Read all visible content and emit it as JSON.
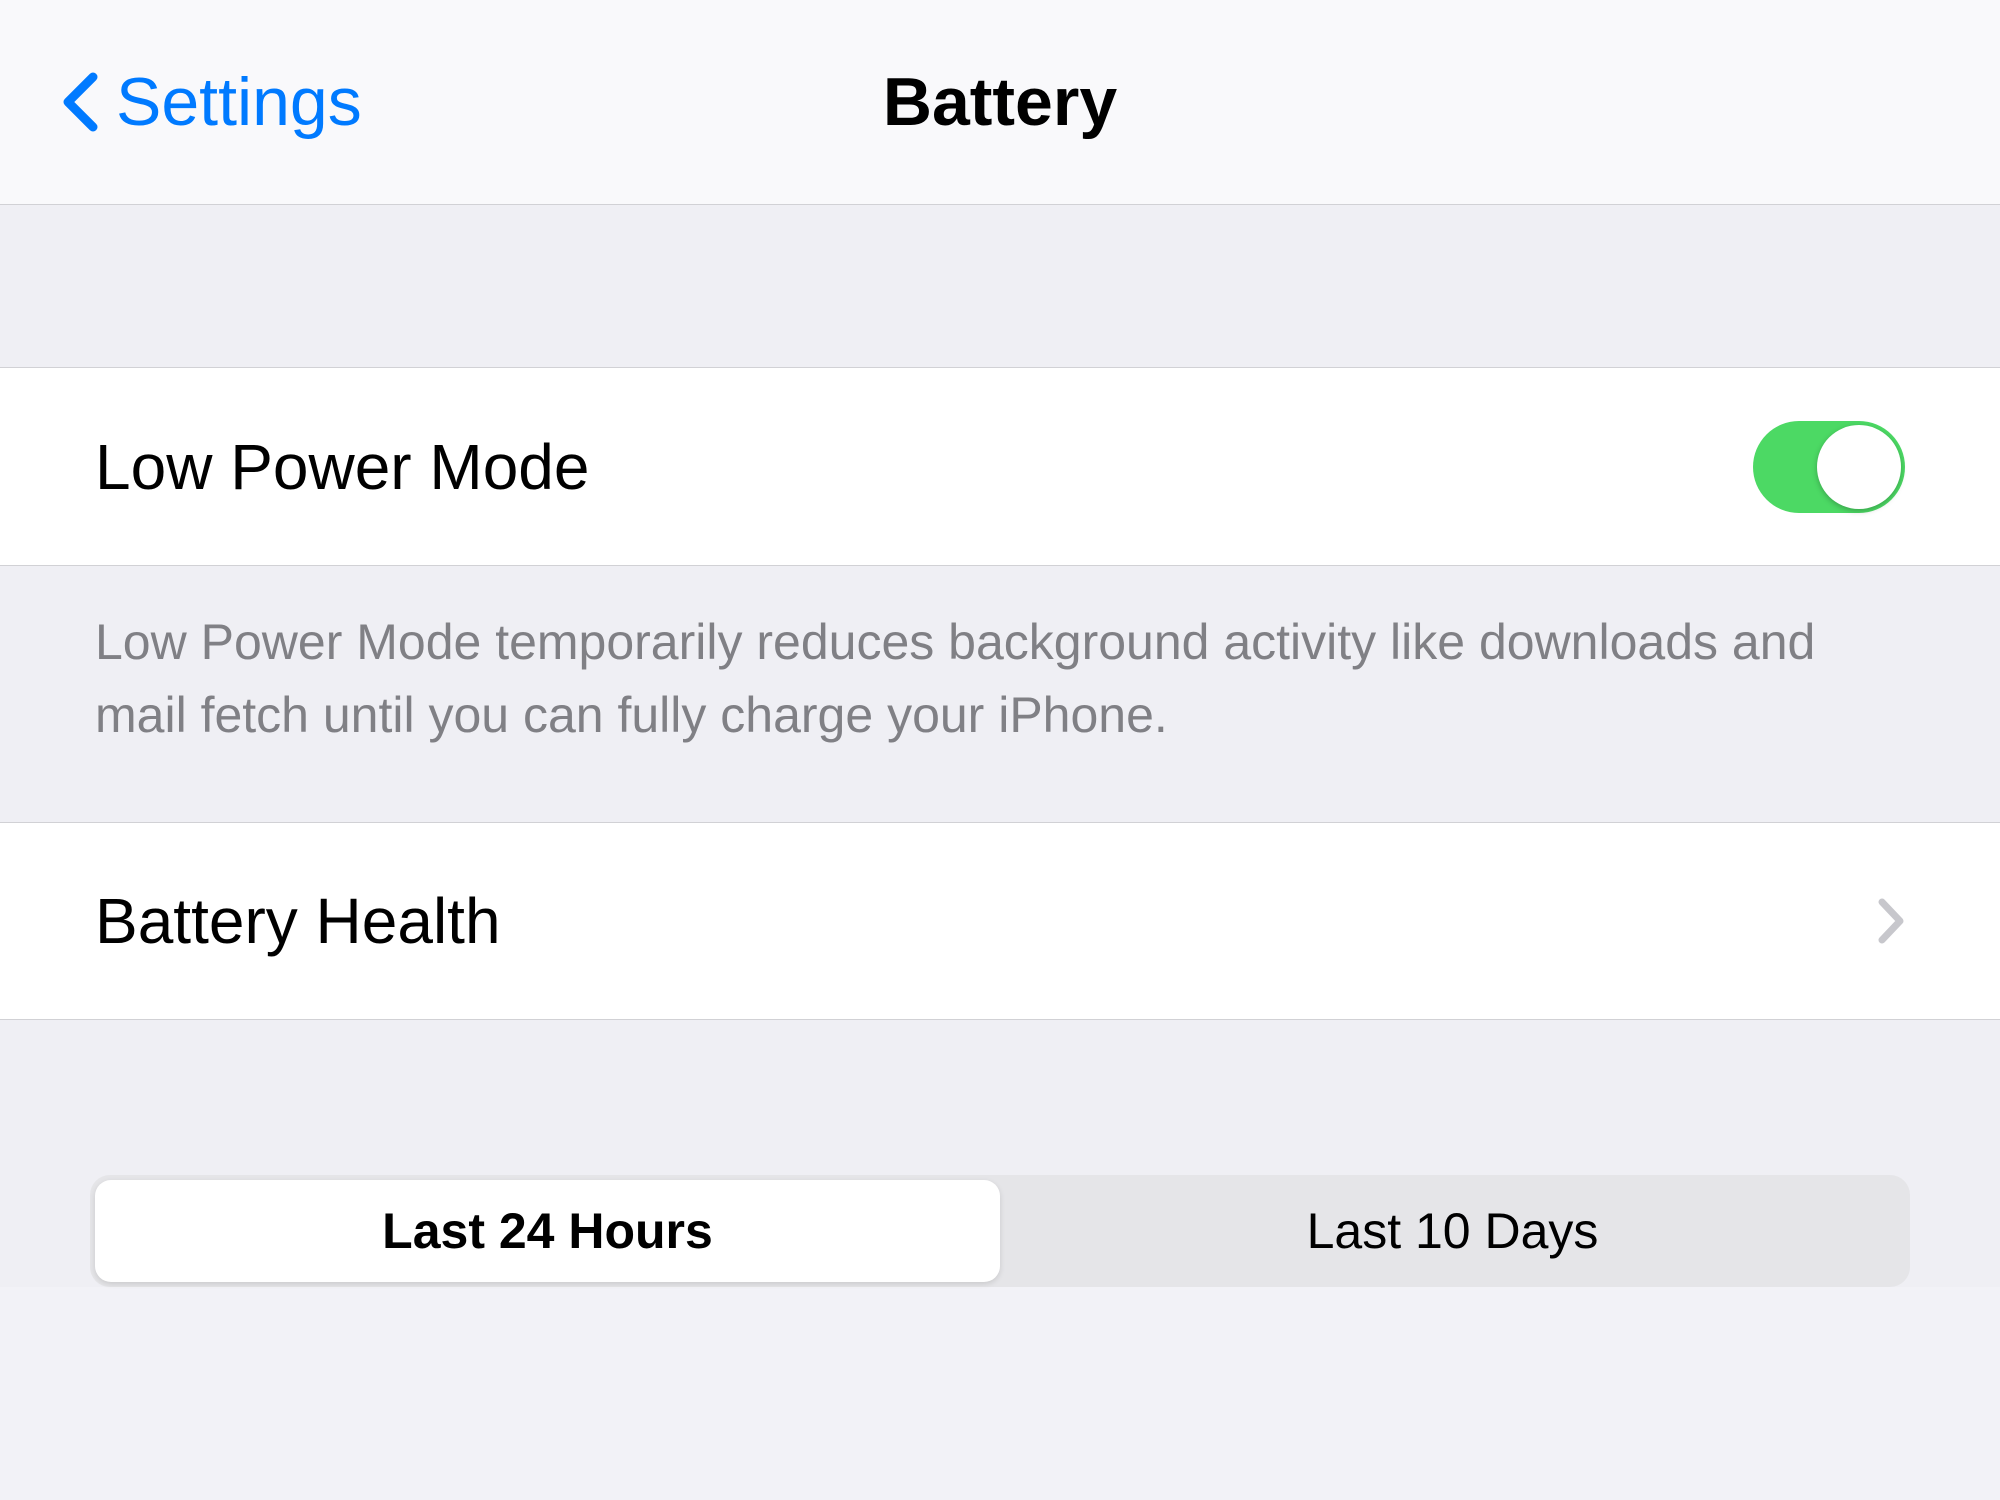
{
  "nav": {
    "back_label": "Settings",
    "title": "Battery"
  },
  "low_power": {
    "label": "Low Power Mode",
    "enabled": true,
    "description": "Low Power Mode temporarily reduces background activity like downloads and mail fetch until you can fully charge your iPhone."
  },
  "battery_health": {
    "label": "Battery Health"
  },
  "segments": {
    "0": {
      "label": "Last 24 Hours"
    },
    "1": {
      "label": "Last 10 Days"
    },
    "selected_index": 0
  },
  "colors": {
    "accent": "#007aff",
    "toggle_on": "#4cd964"
  }
}
